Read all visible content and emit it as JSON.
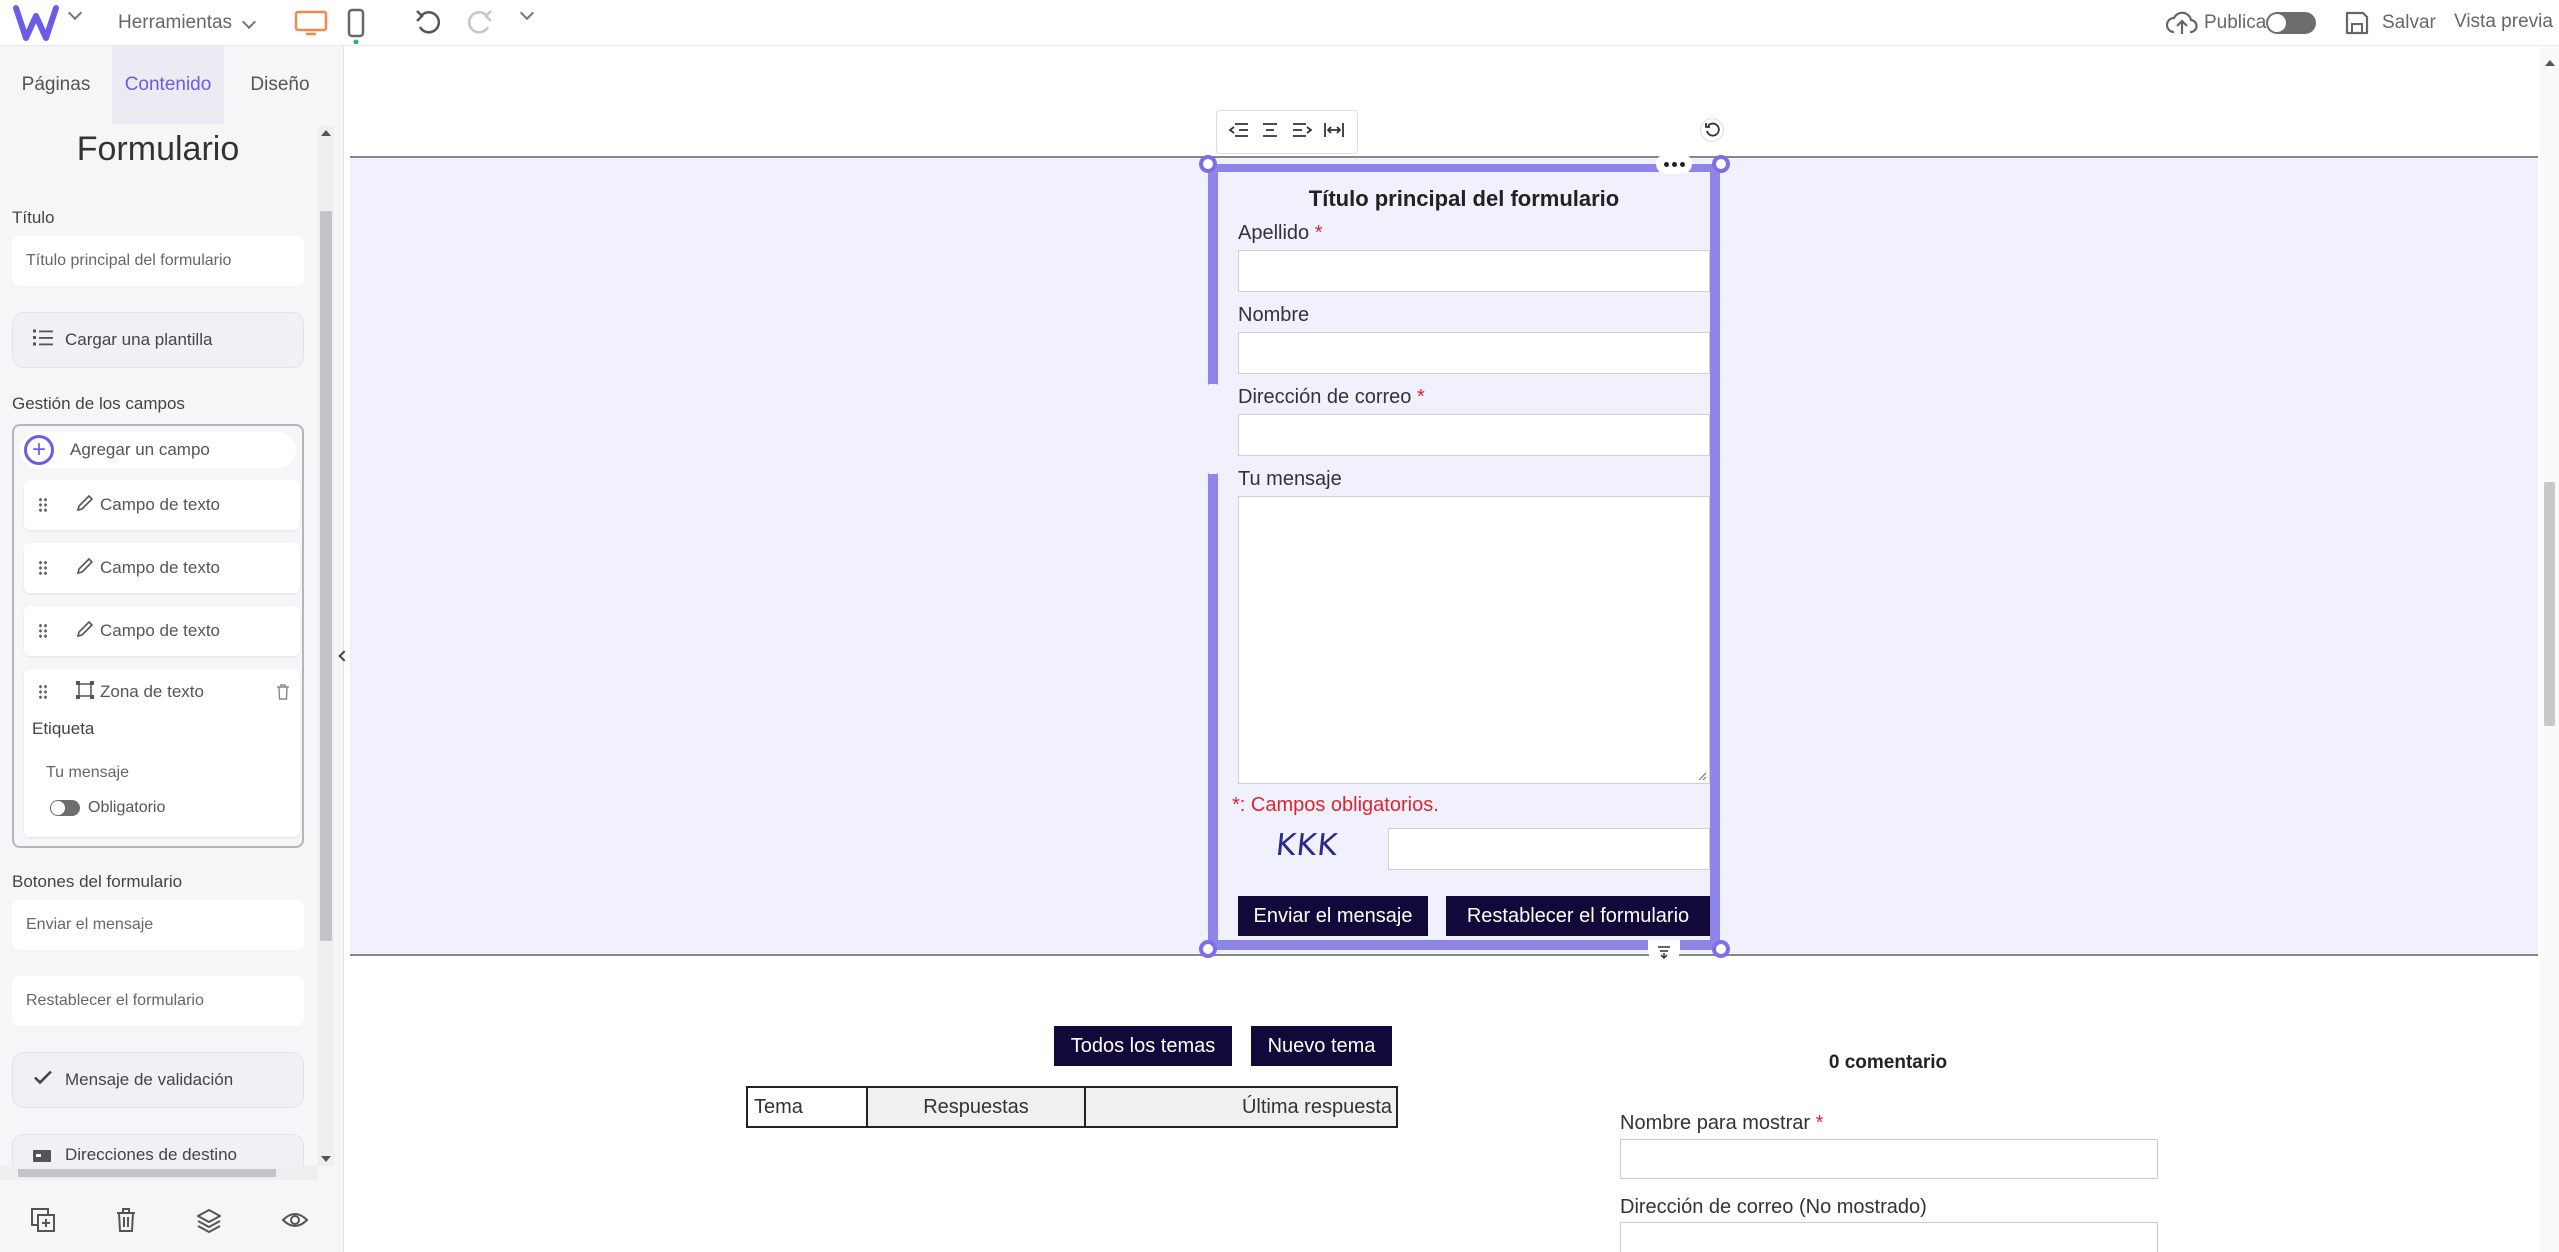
{
  "topbar": {
    "tools_label": "Herramientas",
    "publish_label": "Publicar",
    "save_label": "Salvar",
    "preview_label": "Vista previa"
  },
  "sidebar": {
    "tabs": [
      {
        "label": "Páginas"
      },
      {
        "label": "Contenido"
      },
      {
        "label": "Diseño"
      }
    ],
    "heading": "Formulario",
    "title_label": "Título",
    "title_value": "Título principal del formulario",
    "load_template": "Cargar una plantilla",
    "fields_section": "Gestión de los campos",
    "add_field": "Agregar un campo",
    "fields": [
      {
        "type": "Campo de texto"
      },
      {
        "type": "Campo de texto"
      },
      {
        "type": "Campo de texto"
      },
      {
        "type": "Zona de texto"
      }
    ],
    "expanded_field": {
      "label_caption": "Etiqueta",
      "label_value": "Tu mensaje",
      "required_toggle": "Obligatorio"
    },
    "buttons_section": "Botones del formulario",
    "send_value": "Enviar el mensaje",
    "reset_value": "Restablecer el formulario",
    "validation_message": "Mensaje de validación",
    "destinations": "Direcciones de destino"
  },
  "form": {
    "title": "Título principal del formulario",
    "fields": [
      {
        "label": "Apellido",
        "required": "*"
      },
      {
        "label": "Nombre",
        "required": ""
      },
      {
        "label": "Dirección de correo",
        "required": "*"
      },
      {
        "label": "Tu mensaje",
        "required": ""
      }
    ],
    "required_note": "*: Campos obligatorios.",
    "captcha": "KKK",
    "send_button": "Enviar el mensaje",
    "reset_button": "Restablecer el formulario"
  },
  "forum": {
    "all_topics": "Todos los temas",
    "new_topic": "Nuevo tema",
    "columns": [
      "Tema",
      "Respuestas",
      "Última respuesta"
    ]
  },
  "comments": {
    "count": "0 comentario",
    "display_name_label": "Nombre para mostrar",
    "display_name_required": "*",
    "email_label": "Dirección de correo (No mostrado)"
  },
  "colors": {
    "accent": "#6b5ce7",
    "frame": "#8f84e8",
    "band": "#f1f0fd",
    "dark_button": "#12093a",
    "required": "#e0242e"
  }
}
